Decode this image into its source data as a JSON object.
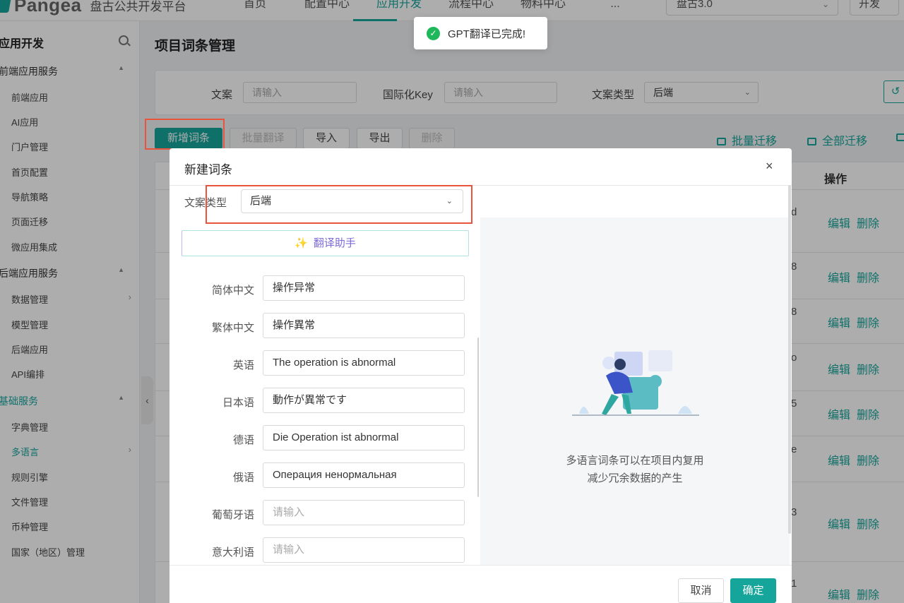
{
  "app": {
    "logo_text": "Pangea",
    "platform": "盘古公共开发平台"
  },
  "topnav": [
    {
      "label": "首页"
    },
    {
      "label": "配置中心"
    },
    {
      "label": "应用开发"
    },
    {
      "label": "流程中心"
    },
    {
      "label": "物料中心"
    },
    {
      "label": "..."
    }
  ],
  "version_select": {
    "value": "盘古3.0"
  },
  "env_select": {
    "value": "开发"
  },
  "sidebar": {
    "title": "应用开发",
    "groups": [
      {
        "label": "前端应用服务",
        "items": [
          "前端应用",
          "AI应用",
          "门户管理",
          "首页配置",
          "导航策略",
          "页面迁移",
          "微应用集成"
        ]
      },
      {
        "label": "后端应用服务",
        "items": [
          "数据管理",
          "模型管理",
          "后端应用",
          "API编排"
        ]
      },
      {
        "label": "基础服务",
        "items": [
          "字典管理",
          "多语言",
          "规则引擎",
          "文件管理",
          "币种管理",
          "国家（地区）管理"
        ]
      }
    ]
  },
  "page": {
    "title": "项目词条管理",
    "filters": {
      "text_label": "文案",
      "text_placeholder": "请输入",
      "key_label": "国际化Key",
      "key_placeholder": "请输入",
      "type_label": "文案类型",
      "type_value": "后端"
    },
    "toolbar": {
      "add": "新增词条",
      "batch_translate": "批量翻译",
      "import": "导入",
      "export": "导出",
      "delete": "删除",
      "batch_migrate": "批量迁移",
      "migrate_all": "全部迁移"
    },
    "table": {
      "op_header": "操作",
      "edit": "编辑",
      "delete": "删除",
      "row_tails": [
        "d",
        "8",
        "8",
        "o",
        "5",
        "e",
        "",
        "3",
        "1"
      ]
    }
  },
  "toast": {
    "message": "GPT翻译已完成!"
  },
  "dialog": {
    "title": "新建词条",
    "type_label": "文案类型",
    "type_value": "后端",
    "assist_label": "翻译助手",
    "fields": [
      {
        "label": "简体中文",
        "value": "操作异常"
      },
      {
        "label": "繁体中文",
        "value": "操作異常"
      },
      {
        "label": "英语",
        "value": "The operation is abnormal"
      },
      {
        "label": "日本语",
        "value": "動作が異常です"
      },
      {
        "label": "德语",
        "value": "Die Operation ist abnormal"
      },
      {
        "label": "俄语",
        "value": "Операция ненормальная"
      },
      {
        "label": "葡萄牙语",
        "value": "",
        "placeholder": "请输入"
      },
      {
        "label": "意大利语",
        "value": "",
        "placeholder": "请输入"
      }
    ],
    "empty_line1": "多语言词条可以在项目内复用",
    "empty_line2": "减少冗余数据的产生",
    "cancel": "取消",
    "ok": "确定"
  },
  "colors": {
    "accent": "#16a59b",
    "highlight": "#e8553c",
    "success": "#1eb85a"
  }
}
